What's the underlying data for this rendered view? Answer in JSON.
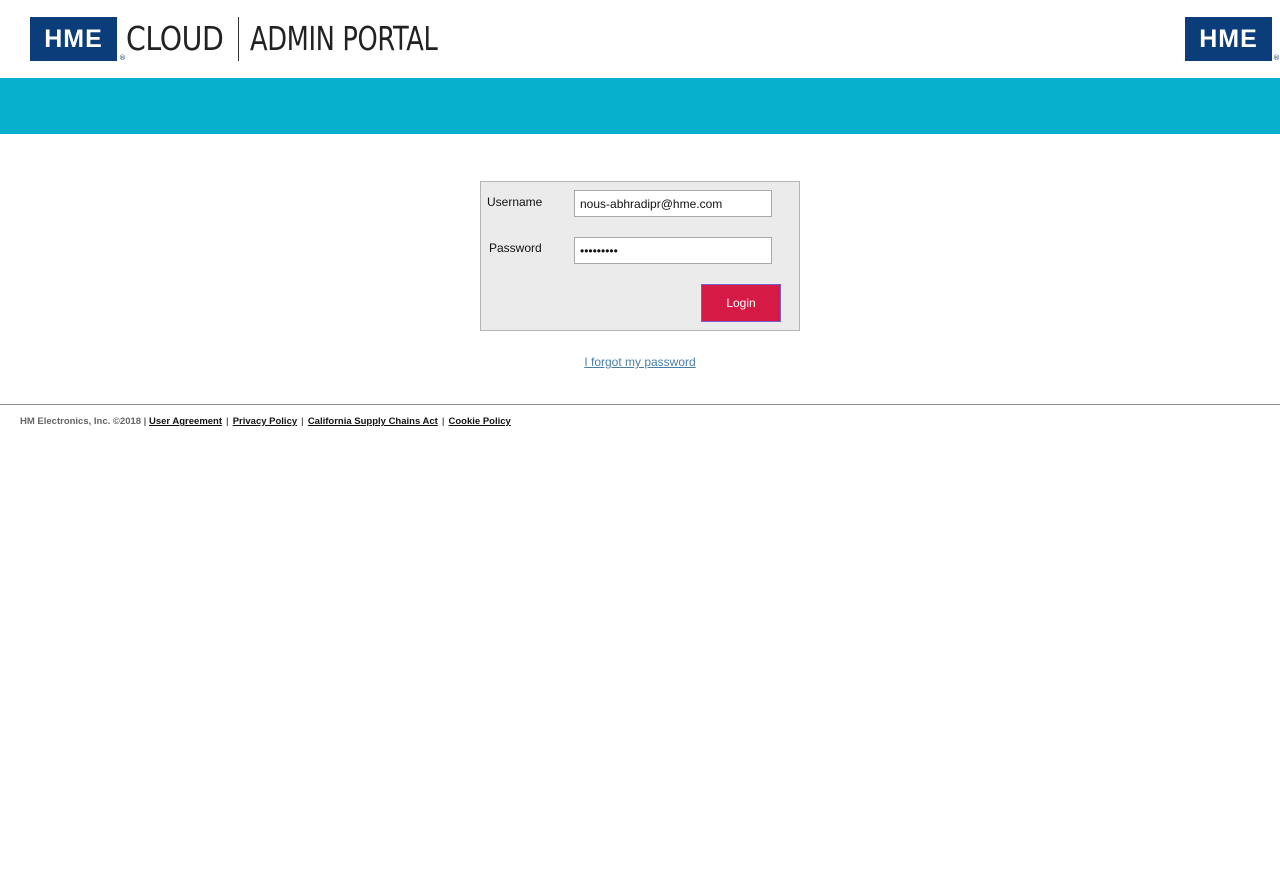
{
  "header": {
    "logo_left": "HME",
    "logo_right": "HME",
    "registered_mark": "®",
    "product": "CLOUD",
    "portal": "ADMIN PORTAL"
  },
  "colors": {
    "brand_blue": "#0a3d7a",
    "banner_teal": "#07b0cc",
    "login_button": "#d51b45",
    "link_blue": "#4a7fa8"
  },
  "login": {
    "username_label": "Username",
    "username_value": "nous-abhradipr@hme.com",
    "password_label": "Password",
    "password_value": "•••••••••",
    "login_button": "Login"
  },
  "forgot_link": "I forgot my password",
  "footer": {
    "copyright": "HM Electronics, Inc. ©2018 |",
    "separator": "|",
    "links": [
      "User Agreement",
      "Privacy Policy",
      "California Supply Chains Act",
      "Cookie Policy"
    ]
  }
}
